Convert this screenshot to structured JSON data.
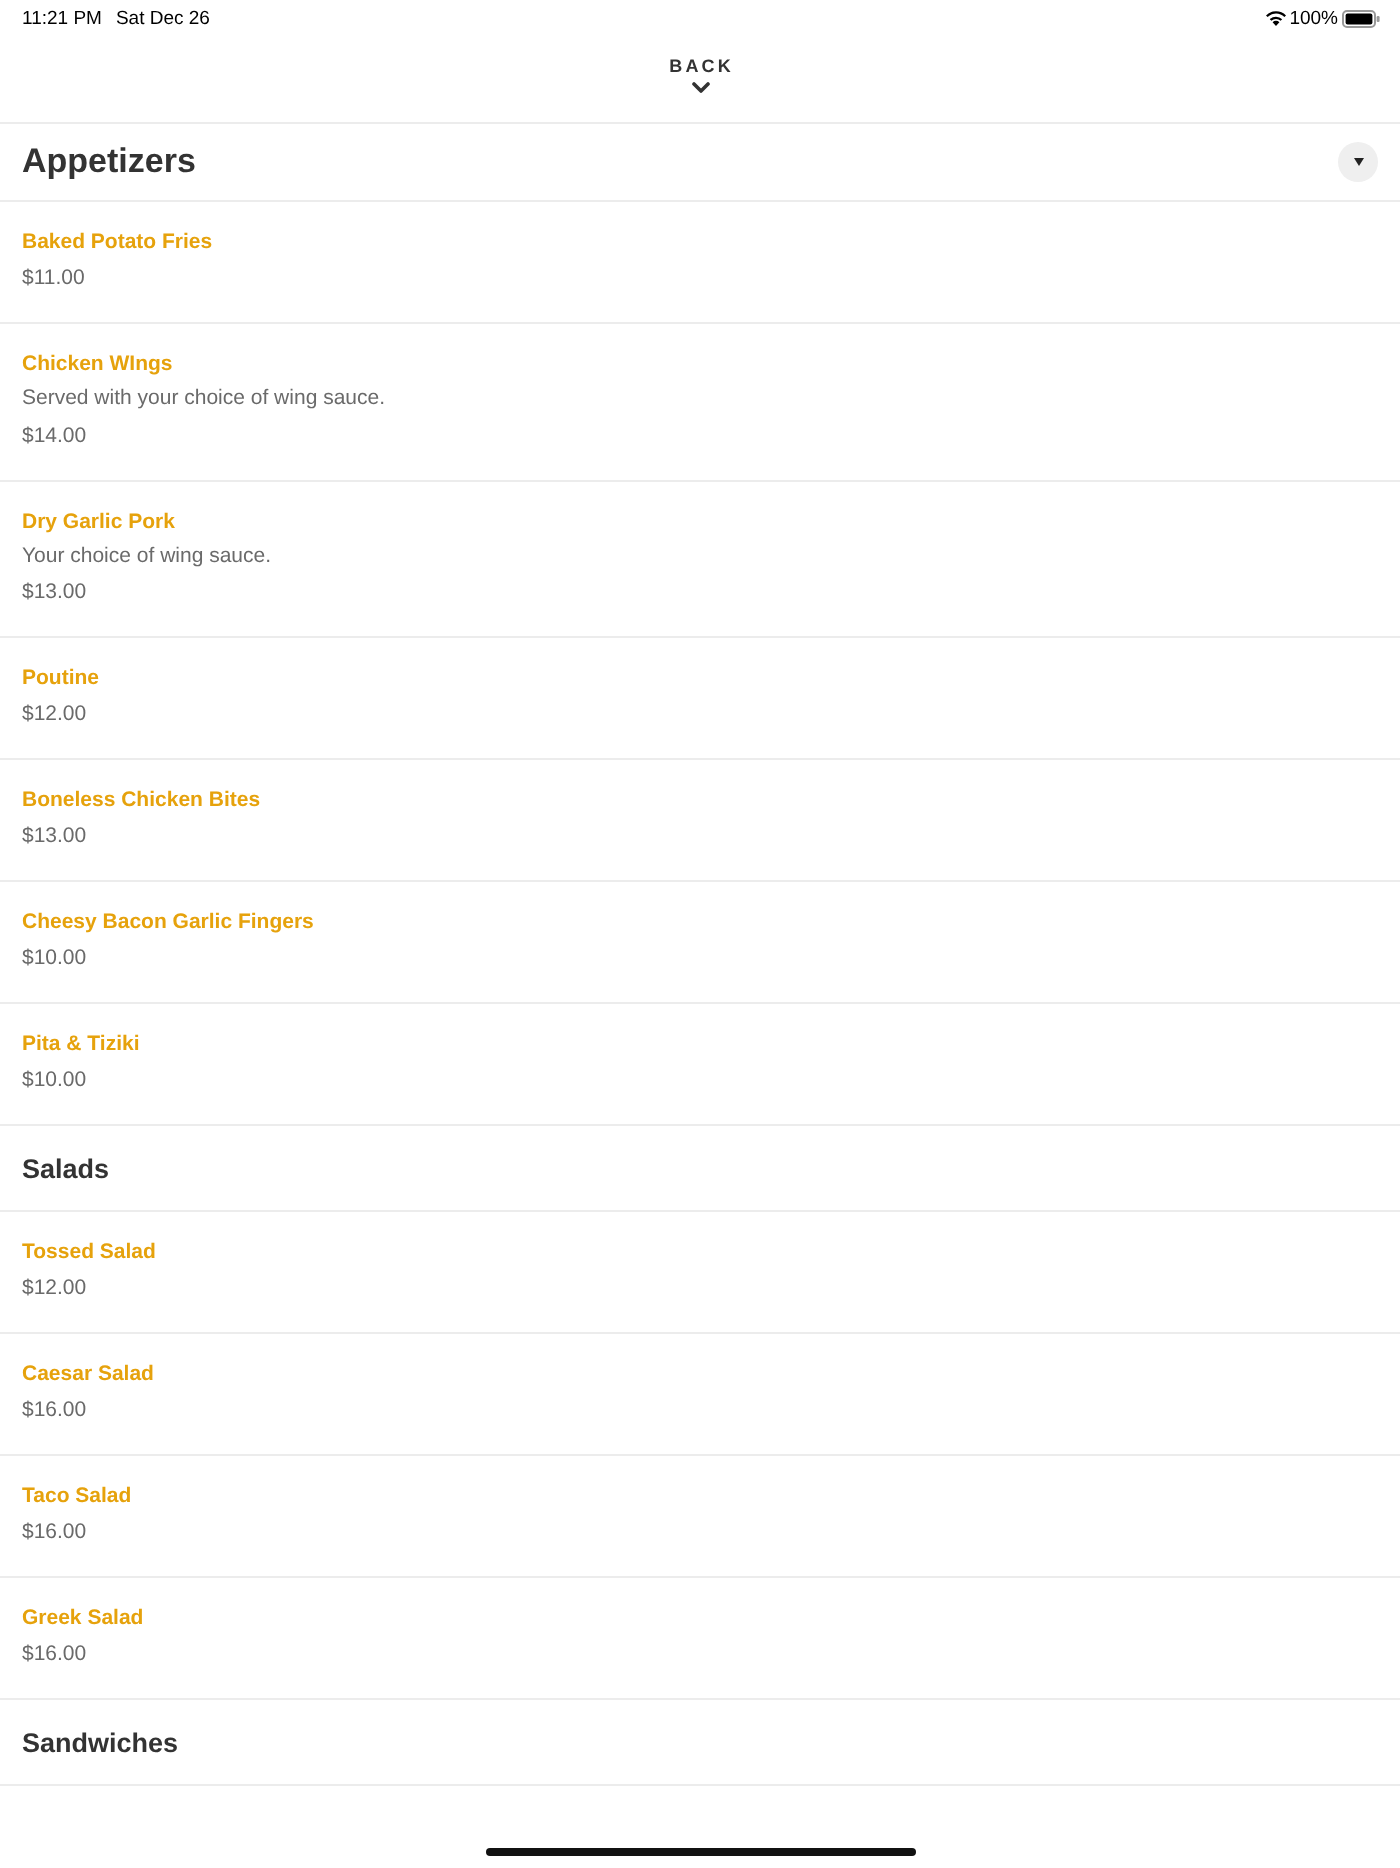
{
  "status_bar": {
    "time": "11:21 PM",
    "date": "Sat Dec 26",
    "battery": "100%"
  },
  "nav": {
    "back_label": "BACK"
  },
  "sections": [
    {
      "kind": "sticky",
      "title": "Appetizers",
      "items": [
        {
          "name": "Baked Potato Fries",
          "price": "$11.00"
        },
        {
          "name": "Chicken WIngs",
          "description": "Served with your choice of wing sauce.",
          "price": "$14.00"
        },
        {
          "name": "Dry Garlic Pork",
          "description": "Your choice of wing sauce.",
          "price": "$13.00"
        },
        {
          "name": "Poutine",
          "price": "$12.00"
        },
        {
          "name": "Boneless Chicken Bites",
          "price": "$13.00"
        },
        {
          "name": "Cheesy Bacon Garlic Fingers",
          "price": "$10.00"
        },
        {
          "name": "Pita & Tiziki",
          "price": "$10.00"
        }
      ]
    },
    {
      "kind": "plain",
      "title": "Salads",
      "items": [
        {
          "name": "Tossed Salad",
          "price": "$12.00"
        },
        {
          "name": "Caesar Salad",
          "price": "$16.00"
        },
        {
          "name": "Taco Salad",
          "price": "$16.00"
        },
        {
          "name": "Greek Salad",
          "price": "$16.00"
        }
      ]
    },
    {
      "kind": "plain",
      "title": "Sandwiches"
    }
  ]
}
